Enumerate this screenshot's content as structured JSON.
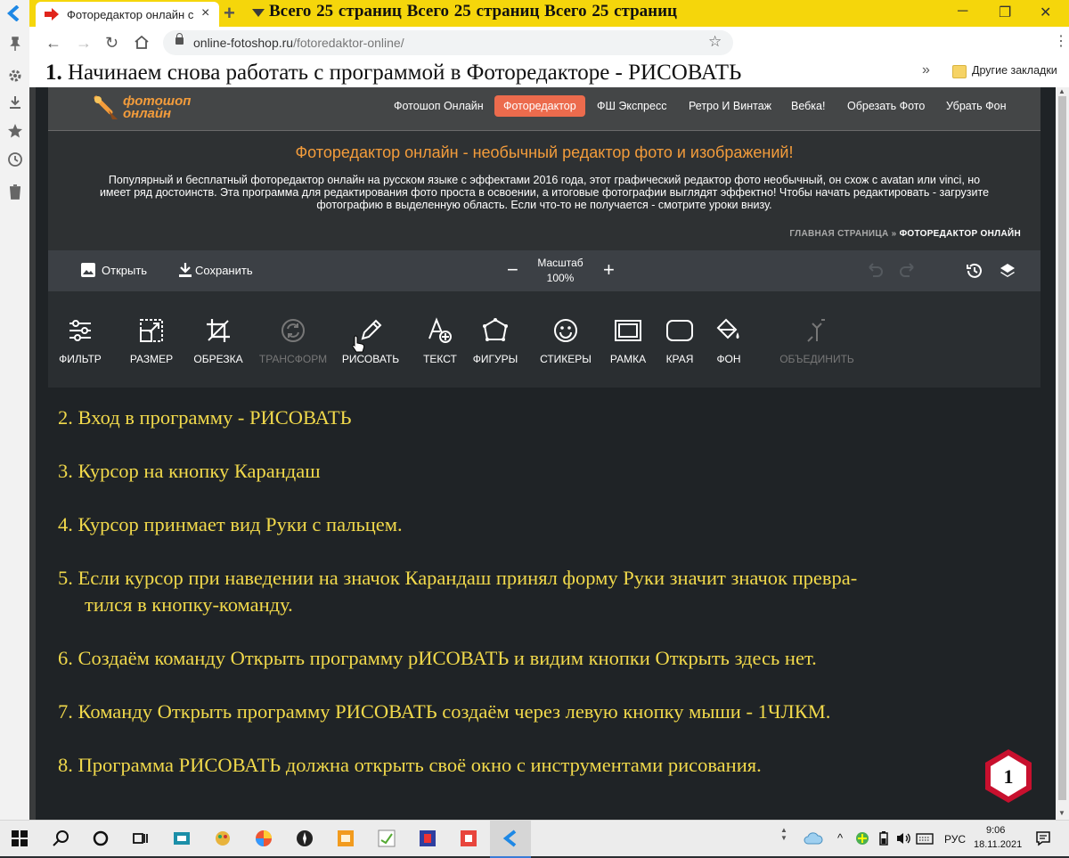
{
  "browser": {
    "tab_title": "Фоторедактор онлайн с",
    "new_tab": "+",
    "banner": "Всего 25 страниц  Всего 25 страниц  Всего 25 страниц",
    "url_domain": "online-fotoshop.ru",
    "url_path": "/fotoredaktor-online/",
    "bookmarks_chevron": "»",
    "bookmarks_folder": "Другие закладки",
    "tab_close": "×",
    "win_minimize": "─",
    "win_restore": "❐",
    "win_close": "✕"
  },
  "heading": {
    "number": "1.",
    "text": " Начинаем снова работать с программой в Фоторедакторе - РИСОВАТЬ"
  },
  "site": {
    "logo_line1": "фотошоп",
    "logo_line2": "онлайн",
    "nav": [
      "Фотошоп Онлайн",
      "Фоторедактор",
      "ФШ Экспресс",
      "Ретро И Винтаж",
      "Вебка!",
      "Обрезать Фото",
      "Убрать Фон"
    ],
    "intro_title": "Фоторедактор онлайн - необычный редактор фото и изображений!",
    "intro_text": "Популярный и бесплатный фоторедактор онлайн на русском языке с эффектами 2016 года, этот графический редактор фото необычный, он схож с avatan или vinci, но имеет ряд достоинств. Эта программа для редактирования фото проста в освоении, а итоговые фотографии выглядят эффектно! Чтобы начать редактировать - загрузите фотографию в выделенную область. Если что-то не получается - смотрите уроки внизу.",
    "crumb_home": "ГЛАВНАЯ СТРАНИЦА",
    "crumb_sep": " » ",
    "crumb_current": "ФОТОРЕДАКТОР ОНЛАЙН"
  },
  "editor": {
    "open": "Открыть",
    "save": "Сохранить",
    "zoom_label": "Масштаб",
    "zoom_value": "100%",
    "zoom_out": "−",
    "zoom_in": "+",
    "tools": [
      {
        "label": "ФИЛЬТР",
        "icon": "sliders-icon"
      },
      {
        "label": "РАЗМЕР",
        "icon": "resize-icon"
      },
      {
        "label": "ОБРЕЗКА",
        "icon": "crop-icon"
      },
      {
        "label": "ТРАНСФОРМ",
        "icon": "transform-icon"
      },
      {
        "label": "РИСОВАТЬ",
        "icon": "pencil-icon"
      },
      {
        "label": "ТЕКСТ",
        "icon": "text-icon"
      },
      {
        "label": "ФИГУРЫ",
        "icon": "shapes-icon"
      },
      {
        "label": "СТИКЕРЫ",
        "icon": "smiley-icon"
      },
      {
        "label": "РАМКА",
        "icon": "frame-icon"
      },
      {
        "label": "КРАЯ",
        "icon": "edges-icon"
      },
      {
        "label": "ФОН",
        "icon": "paint-bucket-icon"
      },
      {
        "label": "ОБЪЕДИНИТЬ",
        "icon": "merge-icon"
      }
    ]
  },
  "notes": [
    "2. Вход в программу - РИСОВАТЬ",
    "3. Курсор на кнопку Карандаш",
    "4. Курсор принмает вид Руки с пальцем.",
    "5. Если курсор при наведении на значок Карандаш принял форму Руки значит значок превра-",
    "тился в кнопку-команду.",
    "6. Создаём команду Открыть программу рИСОВАТЬ и видим кнопки Открыть здесь нет.",
    "7. Команду Открыть программу РИСОВАТЬ создаём через левую кнопку мыши - 1ЧЛКМ.",
    "8. Программа РИСОВАТЬ должна открыть своё окно с инструментами рисования."
  ],
  "badge_number": "1",
  "taskbar": {
    "lang": "РУС",
    "time": "9:06",
    "date": "18.11.2021"
  },
  "colors": {
    "accent_yellow": "#f5d60b",
    "site_orange": "#f39c3b",
    "nav_active": "#ec6b4d",
    "note_text": "#f1d94b",
    "badge_red": "#c8102e"
  }
}
